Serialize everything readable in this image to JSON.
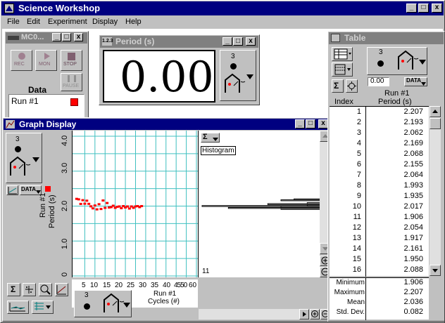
{
  "app": {
    "title": "Science Workshop",
    "menu": [
      "File",
      "Edit",
      "Experiment",
      "Display",
      "Help"
    ]
  },
  "control_window": {
    "title": "MC0...",
    "buttons": [
      "REC",
      "MON",
      "STOP",
      "PAUSE"
    ],
    "data_label": "Data",
    "run_item": "Run #1",
    "run_color": "#ff0000"
  },
  "digits_window": {
    "title": "Period (s)",
    "value": "0.00",
    "input_number": "3"
  },
  "graph_window": {
    "title": "Graph Display",
    "input_number": "3",
    "data_menu": "DATA",
    "ylabel_line1": "Run #1",
    "ylabel_line2": "Period (s)",
    "yticks": [
      "4.0",
      "3.0",
      "2.0",
      "1.0",
      "0"
    ],
    "xticks": [
      "5",
      "10",
      "15",
      "20",
      "25",
      "30",
      "35",
      "40",
      "4550",
      "60"
    ],
    "xlabel_line1": "Run #1",
    "xlabel_line2": "Cycles (#)",
    "stats_menu": "Σ",
    "histogram_label": "Histogram",
    "bin_count": "11",
    "series_color": "#ff0000",
    "grid_color": "#40c0c0",
    "chart_data": {
      "type": "scatter",
      "x": [
        1,
        2,
        3,
        4,
        5,
        6,
        7,
        8,
        9,
        10,
        11,
        12,
        13,
        14,
        15,
        16,
        17,
        18,
        19,
        20,
        21,
        22,
        23,
        24,
        25,
        26,
        27,
        28,
        29,
        30,
        31,
        32,
        33
      ],
      "y": [
        2.207,
        2.193,
        2.062,
        2.169,
        2.068,
        2.155,
        2.064,
        1.993,
        1.935,
        2.017,
        1.906,
        2.054,
        1.917,
        2.161,
        1.95,
        2.088,
        1.96,
        1.97,
        2.01,
        1.95,
        1.98,
        1.99,
        1.94,
        2.0,
        1.96,
        1.99,
        1.93,
        1.99,
        1.95,
        1.99,
        2.0,
        1.97,
        2.0
      ],
      "xlabel": "Run #1 Cycles (#)",
      "ylabel": "Run #1 Period (s)",
      "xlim": [
        0,
        60
      ],
      "ylim": [
        0,
        4.0
      ],
      "grid": true
    }
  },
  "table_window": {
    "title": "Table",
    "input_number": "3",
    "precision": "0.00",
    "data_menu": "DATA",
    "col_index_header": "Index",
    "col_value_header_line1": "Run #1",
    "col_value_header_line2": "Period (s)",
    "rows": [
      {
        "index": "1",
        "value": "2.207"
      },
      {
        "index": "2",
        "value": "2.193"
      },
      {
        "index": "3",
        "value": "2.062"
      },
      {
        "index": "4",
        "value": "2.169"
      },
      {
        "index": "5",
        "value": "2.068"
      },
      {
        "index": "6",
        "value": "2.155"
      },
      {
        "index": "7",
        "value": "2.064"
      },
      {
        "index": "8",
        "value": "1.993"
      },
      {
        "index": "9",
        "value": "1.935"
      },
      {
        "index": "10",
        "value": "2.017"
      },
      {
        "index": "11",
        "value": "1.906"
      },
      {
        "index": "12",
        "value": "2.054"
      },
      {
        "index": "13",
        "value": "1.917"
      },
      {
        "index": "14",
        "value": "2.161"
      },
      {
        "index": "15",
        "value": "1.950"
      },
      {
        "index": "16",
        "value": "2.088"
      }
    ],
    "stats": [
      {
        "label": "Minimum",
        "value": "1.906"
      },
      {
        "label": "Maximum",
        "value": "2.207"
      },
      {
        "label": "Mean",
        "value": "2.036"
      },
      {
        "label": "Std. Dev.",
        "value": "0.082"
      }
    ]
  }
}
